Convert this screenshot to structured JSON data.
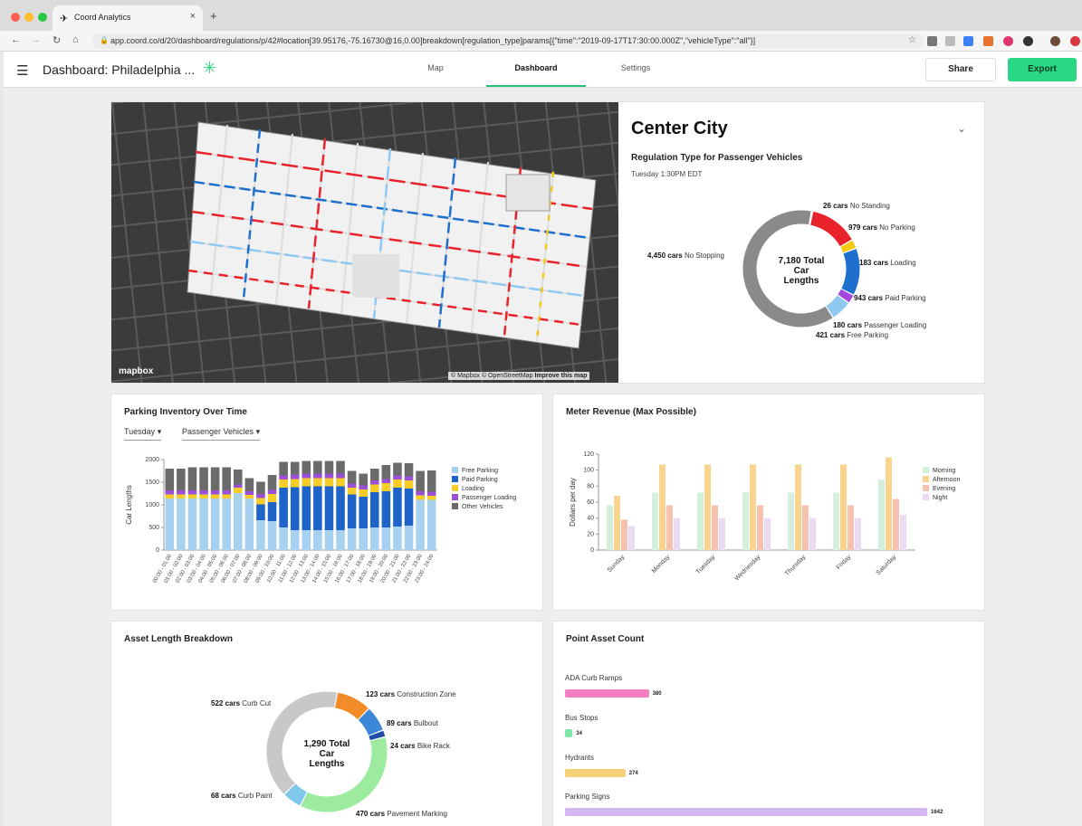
{
  "browser": {
    "tab_title": "Coord Analytics",
    "url": "app.coord.co/d/20/dashboard/regulations/p/42#location[39.95176,-75.16730@16,0.00]breakdown[regulation_type]params[{\"time\":\"2019-09-17T17:30:00.000Z\",\"vehicleType\":\"all\"}]"
  },
  "header": {
    "title": "Dashboard: Philadelphia ...",
    "tabs": [
      "Map",
      "Dashboard",
      "Settings"
    ],
    "active_tab": "Dashboard",
    "share_label": "Share",
    "export_label": "Export",
    "accent": "#2bd885"
  },
  "map": {
    "logo": "mapbox",
    "attribution": "© Mapbox © OpenStreetMap",
    "improve": "Improve this map"
  },
  "center_city": {
    "title": "Center City",
    "subtitle": "Regulation Type for Passenger Vehicles",
    "time": "Tuesday 1:30PM EDT",
    "center_lines": [
      "7,180 Total",
      "Car",
      "Lengths"
    ],
    "chart_data": {
      "type": "pie",
      "title": "7,180 Total Car Lengths",
      "slices": [
        {
          "label": "No Standing",
          "value": 26,
          "text": "26 cars",
          "color": "#b0b0b0"
        },
        {
          "label": "No Parking",
          "value": 979,
          "text": "979 cars",
          "color": "#e8232b"
        },
        {
          "label": "Loading",
          "value": 183,
          "text": "183 cars",
          "color": "#f5c816"
        },
        {
          "label": "Paid Parking",
          "value": 943,
          "text": "943 cars",
          "color": "#1f6fce"
        },
        {
          "label": "Passenger Loading",
          "value": 180,
          "text": "180 cars",
          "color": "#a347e0"
        },
        {
          "label": "Free Parking",
          "value": 421,
          "text": "421 cars",
          "color": "#8fc8f0"
        },
        {
          "label": "No Stopping",
          "value": 4450,
          "text": "4,450 cars",
          "color": "#8a8a8a"
        }
      ]
    }
  },
  "inventory": {
    "title": "Parking Inventory Over Time",
    "day_select": "Tuesday",
    "vehicle_select": "Passenger Vehicles",
    "chart_data": {
      "type": "bar",
      "stacked": true,
      "ylabel": "Car Lengths",
      "ylim": [
        0,
        2000
      ],
      "yticks": [
        0,
        500,
        1000,
        1500,
        2000
      ],
      "categories": [
        "00:00 - 01:00",
        "01:00 - 02:00",
        "02:00 - 03:00",
        "03:00 - 04:00",
        "04:00 - 05:00",
        "05:00 - 06:00",
        "06:00 - 07:00",
        "07:00 - 08:00",
        "08:00 - 09:00",
        "09:00 - 10:00",
        "10:00 - 11:00",
        "11:00 - 12:00",
        "12:00 - 13:00",
        "13:00 - 14:00",
        "14:00 - 15:00",
        "15:00 - 16:00",
        "16:00 - 17:00",
        "17:00 - 18:00",
        "18:00 - 19:00",
        "19:00 - 20:00",
        "20:00 - 21:00",
        "21:00 - 22:00",
        "22:00 - 23:00",
        "23:00 - 24:00"
      ],
      "series": [
        {
          "name": "Free Parking",
          "color": "#a8d1ef",
          "values": [
            1140,
            1140,
            1140,
            1140,
            1140,
            1140,
            1260,
            1140,
            660,
            640,
            500,
            440,
            440,
            440,
            440,
            440,
            480,
            480,
            500,
            500,
            520,
            540,
            1110,
            1110
          ]
        },
        {
          "name": "Paid Parking",
          "color": "#1e64c8",
          "values": [
            0,
            0,
            0,
            0,
            0,
            0,
            0,
            0,
            350,
            420,
            880,
            950,
            970,
            970,
            970,
            970,
            750,
            700,
            780,
            800,
            860,
            820,
            0,
            0
          ]
        },
        {
          "name": "Loading",
          "color": "#f5cd26",
          "values": [
            90,
            90,
            90,
            90,
            90,
            90,
            120,
            80,
            140,
            180,
            180,
            180,
            180,
            180,
            180,
            180,
            150,
            160,
            170,
            180,
            180,
            180,
            100,
            90
          ]
        },
        {
          "name": "Passenger Loading",
          "color": "#9b4fd8",
          "values": [
            90,
            90,
            90,
            90,
            90,
            90,
            70,
            80,
            90,
            90,
            90,
            100,
            100,
            100,
            100,
            100,
            90,
            90,
            90,
            90,
            90,
            90,
            90,
            90
          ]
        },
        {
          "name": "Other Vehicles",
          "color": "#6b6b6b",
          "values": [
            480,
            480,
            510,
            510,
            510,
            510,
            330,
            290,
            270,
            330,
            300,
            280,
            280,
            280,
            280,
            280,
            280,
            260,
            260,
            310,
            280,
            290,
            450,
            470
          ]
        }
      ]
    }
  },
  "revenue": {
    "title": "Meter Revenue (Max Possible)",
    "chart_data": {
      "type": "bar",
      "ylabel": "Dollars per day",
      "ylim": [
        0,
        120
      ],
      "yticks": [
        0,
        20,
        40,
        60,
        80,
        100,
        120
      ],
      "categories": [
        "Sunday",
        "Monday",
        "Tuesday",
        "Wednesday",
        "Thursday",
        "Friday",
        "Saturday"
      ],
      "series": [
        {
          "name": "Morning",
          "color": "#d4f0dc",
          "values": [
            56,
            72,
            72,
            72,
            72,
            72,
            88
          ]
        },
        {
          "name": "Afternoon",
          "color": "#f8d48e",
          "values": [
            68,
            107,
            107,
            107,
            107,
            107,
            116
          ]
        },
        {
          "name": "Evening",
          "color": "#f5c2b0",
          "values": [
            38,
            56,
            56,
            56,
            56,
            56,
            64
          ]
        },
        {
          "name": "Night",
          "color": "#ecdaf2",
          "values": [
            30,
            40,
            40,
            40,
            40,
            40,
            44
          ]
        }
      ]
    }
  },
  "asset": {
    "title": "Asset Length Breakdown",
    "center_lines": [
      "1,290 Total",
      "Car",
      "Lengths"
    ],
    "chart_data": {
      "type": "pie",
      "title": "1,290 Total Car Lengths",
      "slices": [
        {
          "label": "Construction Zone",
          "value": 123,
          "text": "123 cars",
          "color": "#f28c28"
        },
        {
          "label": "Bulbout",
          "value": 89,
          "text": "89 cars",
          "color": "#3c87d8"
        },
        {
          "label": "Bike Rack",
          "value": 24,
          "text": "24 cars",
          "color": "#1f4fa8"
        },
        {
          "label": "Pavement Marking",
          "value": 470,
          "text": "470 cars",
          "color": "#9ceb9f"
        },
        {
          "label": "Curb Paint",
          "value": 68,
          "text": "68 cars",
          "color": "#7fc8ec"
        },
        {
          "label": "Curb Cut",
          "value": 522,
          "text": "522 cars",
          "color": "#c8c8c8"
        }
      ]
    }
  },
  "point": {
    "title": "Point Asset Count",
    "chart_data": {
      "type": "bar",
      "orientation": "horizontal",
      "categories": [
        "ADA Curb Ramps",
        "Bus Stops",
        "Hydrants",
        "Parking Signs"
      ],
      "values": [
        380,
        34,
        274,
        1642
      ],
      "colors": [
        "#f47fc0",
        "#7ee6a6",
        "#f5d077",
        "#d4b6f2"
      ]
    }
  }
}
